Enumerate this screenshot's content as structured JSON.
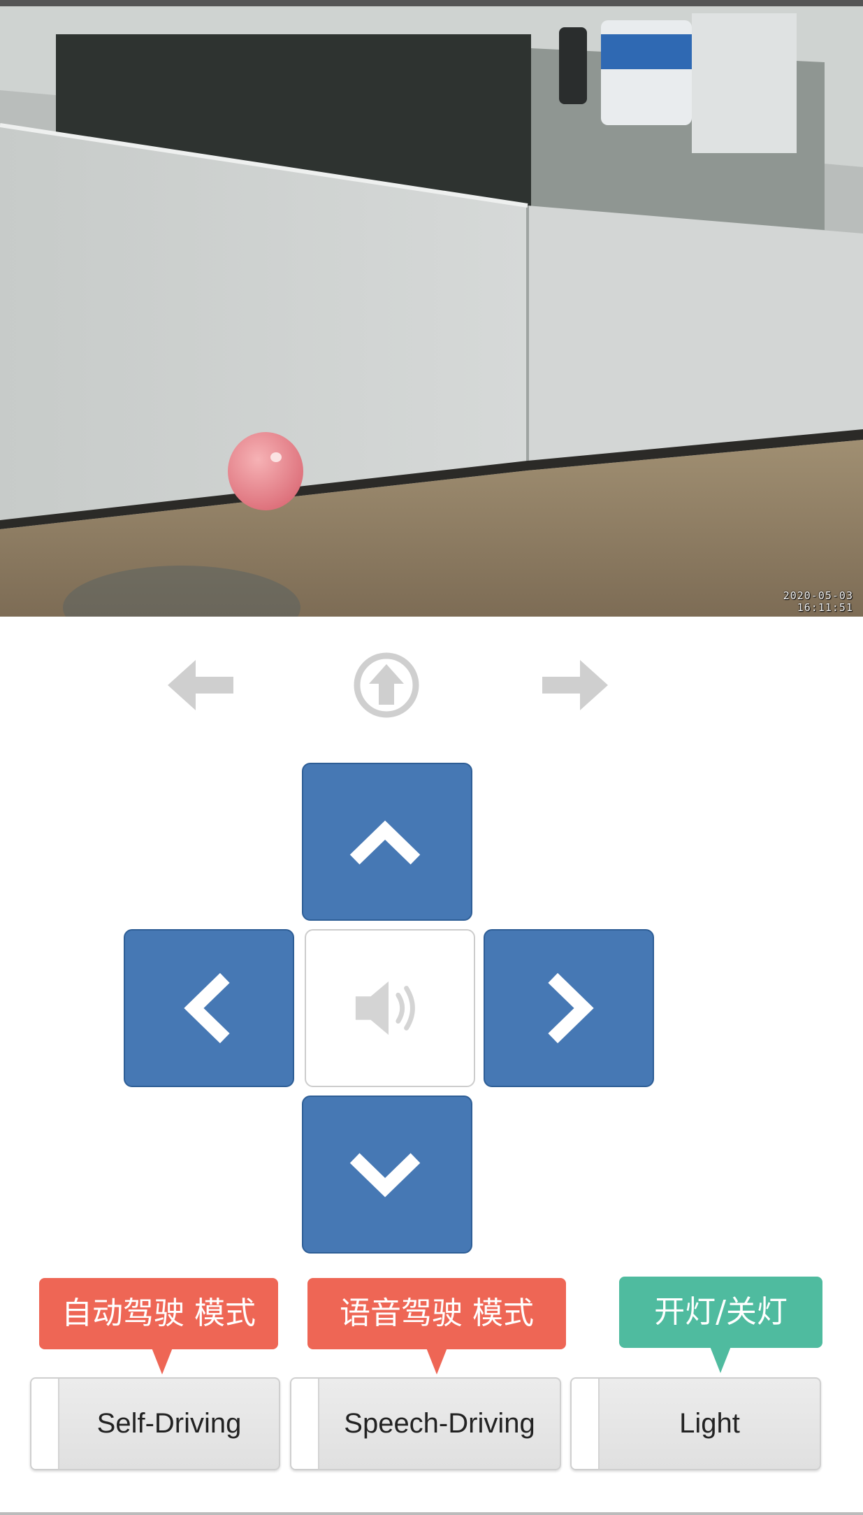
{
  "camera": {
    "timestamp_date": "2020-05-03",
    "timestamp_time": "16:11:51"
  },
  "nav_icons": [
    "arrow-left-icon",
    "arrow-up-circle-icon",
    "arrow-right-icon"
  ],
  "dpad": {
    "up": "chevron-up-icon",
    "left": "chevron-left-icon",
    "center": "speaker-icon",
    "right": "chevron-right-icon",
    "down": "chevron-down-icon"
  },
  "modes": [
    {
      "tag": "自动驾驶 模式",
      "button": "Self-Driving",
      "tag_color": "#ee6655"
    },
    {
      "tag": "语音驾驶 模式",
      "button": "Speech-Driving",
      "tag_color": "#ee6655"
    },
    {
      "tag": "开灯/关灯",
      "button": "Light",
      "tag_color": "#4fbb9f"
    }
  ],
  "colors": {
    "pad_blue": "#4678b4",
    "icon_gray": "#cfcfcf"
  }
}
